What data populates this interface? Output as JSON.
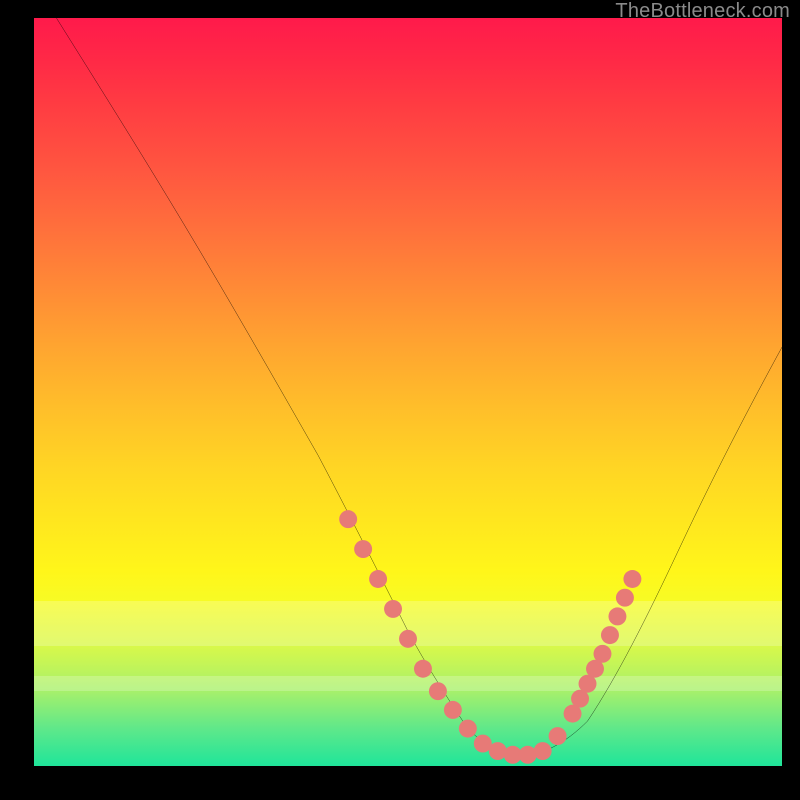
{
  "watermark": "TheBottleneck.com",
  "chart_data": {
    "type": "line",
    "title": "",
    "xlabel": "",
    "ylabel": "",
    "xlim": [
      0,
      100
    ],
    "ylim": [
      0,
      100
    ],
    "series": [
      {
        "name": "curve",
        "x": [
          3,
          8,
          14,
          20,
          26,
          32,
          38,
          43,
          47,
          50,
          53,
          56,
          58,
          60,
          62,
          65,
          68,
          71,
          74,
          78,
          82,
          86,
          90,
          94,
          100
        ],
        "y": [
          100,
          92,
          82.5,
          72.5,
          62.5,
          52,
          41.5,
          32,
          24,
          18,
          12.5,
          8,
          5,
          3,
          1.8,
          1.2,
          1.5,
          3,
          6,
          12,
          20,
          28.5,
          37,
          45,
          56
        ]
      }
    ],
    "markers": {
      "name": "highlight-dots",
      "color": "#e77a77",
      "x": [
        42,
        44,
        46,
        48,
        50,
        52,
        54,
        56,
        58,
        60,
        62,
        64,
        66,
        68,
        70,
        72,
        73,
        74,
        75,
        76,
        77,
        78,
        79,
        80
      ],
      "y": [
        33,
        29,
        25,
        21,
        17,
        13,
        10,
        7.5,
        5,
        3,
        2,
        1.5,
        1.5,
        2,
        4,
        7,
        9,
        11,
        13,
        15,
        17.5,
        20,
        22.5,
        25
      ]
    },
    "bands": [
      {
        "name": "pale-band-1",
        "y0": 78,
        "y1": 84
      },
      {
        "name": "pale-band-2",
        "y0": 88,
        "y1": 90
      }
    ]
  }
}
